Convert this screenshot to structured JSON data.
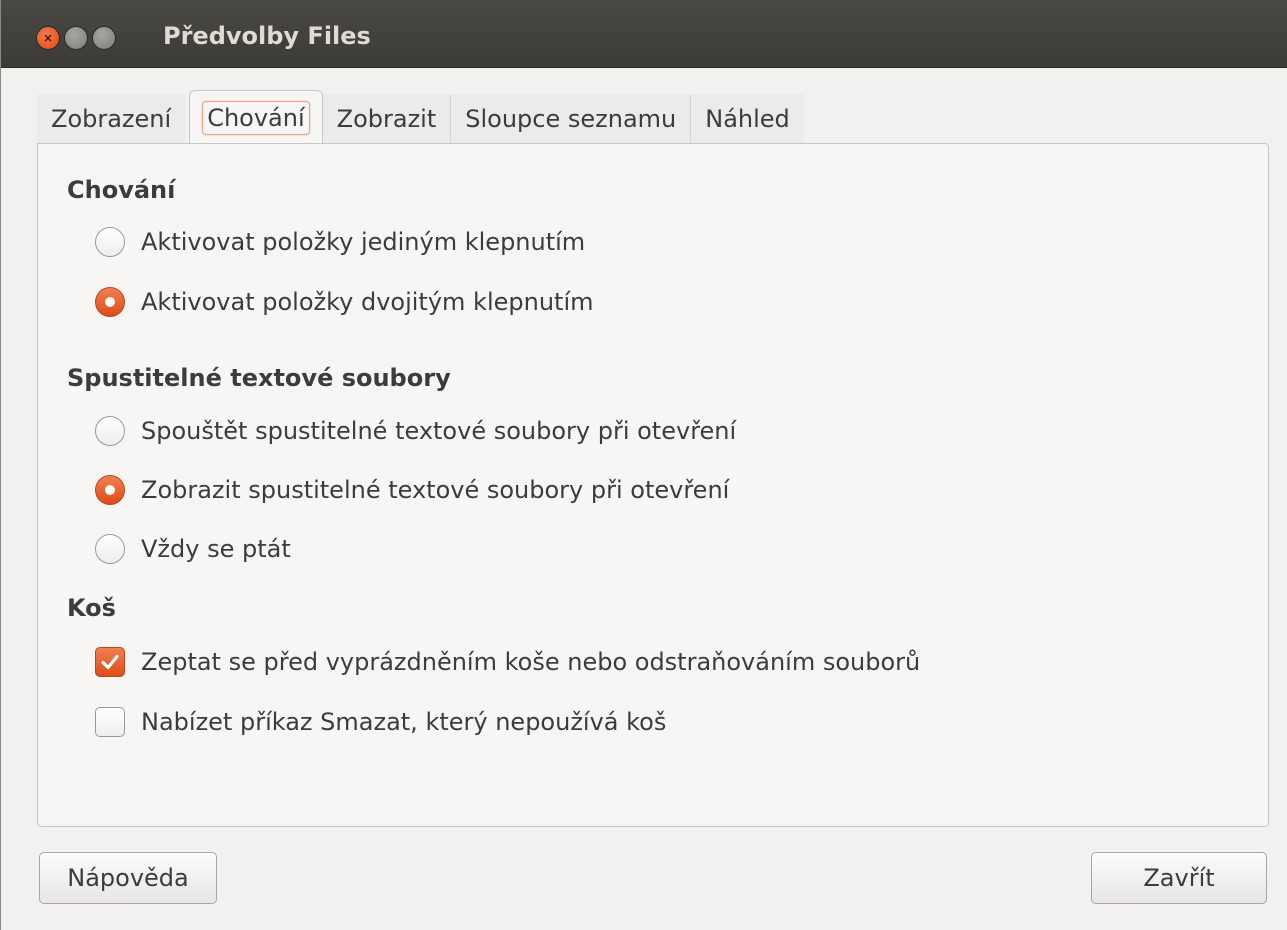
{
  "window": {
    "title": "Předvolby Files"
  },
  "titlebar_buttons": {
    "close_glyph": "×",
    "minimize_glyph": "–",
    "maximize_glyph": "□"
  },
  "tabs": [
    {
      "label": "Zobrazení",
      "active": false
    },
    {
      "label": "Chování",
      "active": true
    },
    {
      "label": "Zobrazit",
      "active": false
    },
    {
      "label": "Sloupce seznamu",
      "active": false
    },
    {
      "label": "Náhled",
      "active": false
    }
  ],
  "sections": {
    "behavior": {
      "title": "Chování",
      "options": [
        {
          "label": "Aktivovat položky jediným klepnutím",
          "selected": false
        },
        {
          "label": "Aktivovat položky dvojitým klepnutím",
          "selected": true
        }
      ]
    },
    "executable": {
      "title": "Spustitelné textové soubory",
      "options": [
        {
          "label": "Spouštět spustitelné textové soubory při otevření",
          "selected": false
        },
        {
          "label": "Zobrazit spustitelné textové soubory při otevření",
          "selected": true
        },
        {
          "label": "Vždy se ptát",
          "selected": false
        }
      ]
    },
    "trash": {
      "title": "Koš",
      "options": [
        {
          "label": "Zeptat se před vyprázdněním koše nebo odstraňováním souborů",
          "checked": true
        },
        {
          "label": "Nabízet příkaz Smazat, který nepoužívá koš",
          "checked": false
        }
      ]
    }
  },
  "buttons": {
    "help_label": "Nápověda",
    "close_label": "Zavřít"
  },
  "colors": {
    "accent": "#dd4c17",
    "titlebar": "#3c3b37",
    "background": "#f2f1f0"
  }
}
